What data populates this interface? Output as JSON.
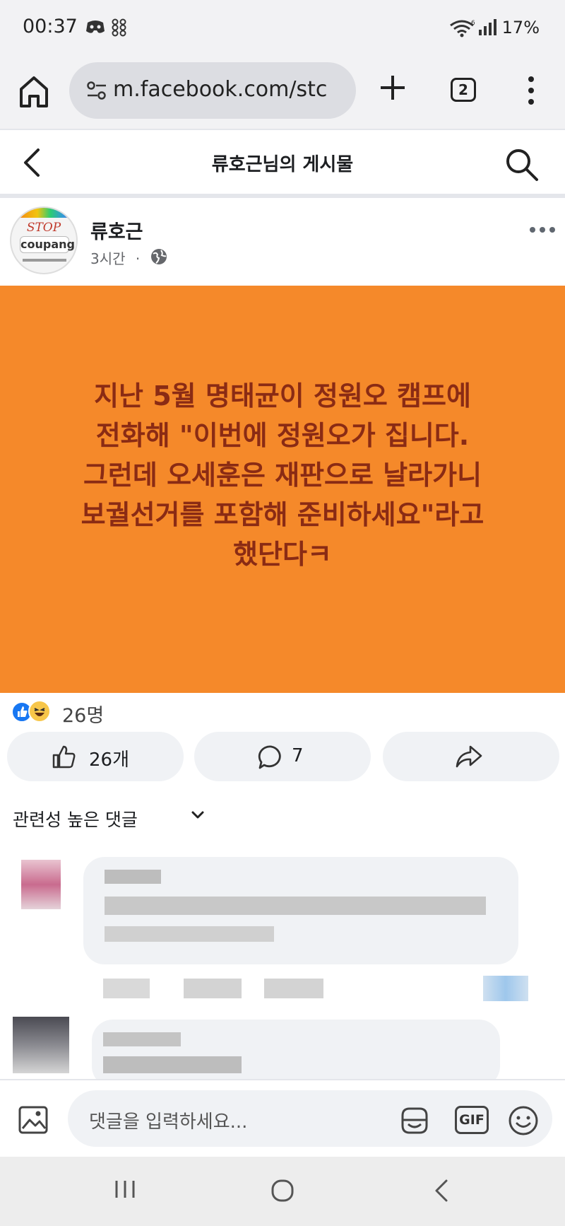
{
  "status_bar": {
    "time": "00:37",
    "battery": "17%",
    "icons": [
      "discord-icon",
      "app-grid-icon",
      "wifi-icon",
      "signal-icon"
    ]
  },
  "browser": {
    "url": "m.facebook.com/stc",
    "tab_count": "2",
    "icons": [
      "home-icon",
      "tune-icon",
      "plus-icon",
      "more-vert-icon"
    ]
  },
  "page": {
    "title": "류호근님의 게시물"
  },
  "post": {
    "author": "류호근",
    "time": "3시간",
    "separator": "·",
    "avatar_text_stop": "STOP",
    "avatar_text_brand": "coupang",
    "background_color": "#f5892a",
    "text_color": "#8a2b14",
    "text_lines": [
      "지난 5월 명태균이 정원오 캠프에",
      "전화해 \"이번에 정원오가 집니다.",
      "그런데 오세훈은 재판으로 날라가니",
      "보궐선거를 포함해 준비하세요\"라고",
      "했단다ㅋ"
    ]
  },
  "reactions": {
    "count": "26명",
    "types": [
      "like-icon",
      "haha-icon"
    ]
  },
  "actions": {
    "like_label": "26개",
    "comment_label": "7",
    "share_label": ""
  },
  "comments": {
    "sort_label": "관련성 높은 댓글"
  },
  "composer": {
    "placeholder": "댓글을 입력하세요...",
    "gif_label": "GIF"
  }
}
